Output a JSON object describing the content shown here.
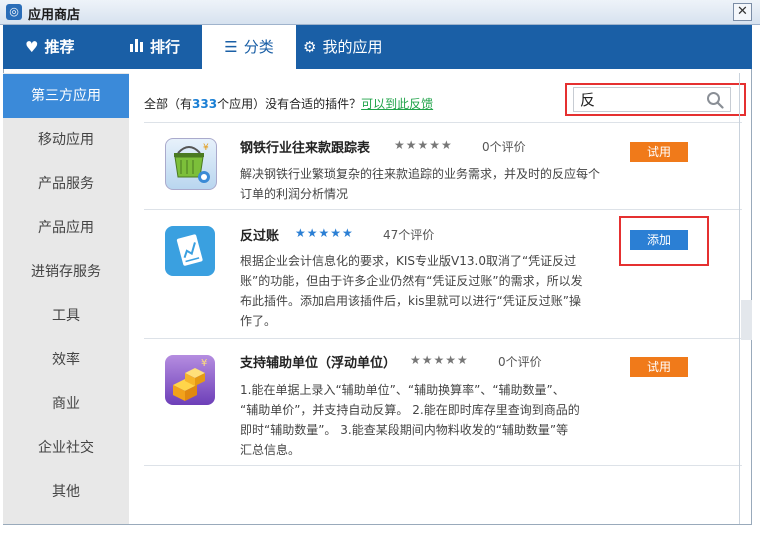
{
  "window": {
    "title": "应用商店",
    "close_glyph": "✕"
  },
  "tabs": [
    {
      "label": "推荐",
      "icon": "heart-icon",
      "glyph": "♥"
    },
    {
      "label": "排行",
      "icon": "bar-chart-icon",
      "glyph": "📊"
    },
    {
      "label": "分类",
      "icon": "list-icon",
      "glyph": "☰"
    },
    {
      "label": "我的应用",
      "icon": "gear-icon",
      "glyph": "⚙"
    }
  ],
  "active_tab": "分类",
  "sidebar": {
    "items": [
      "第三方应用",
      "移动应用",
      "产品服务",
      "产品应用",
      "进销存服务",
      "工具",
      "效率",
      "商业",
      "企业社交",
      "其他"
    ],
    "active": "第三方应用"
  },
  "summary": {
    "prefix": "全部（有",
    "count": "333",
    "suffix": "个应用）没有合适的插件？",
    "link": "可以到此反馈"
  },
  "search": {
    "value": "反",
    "placeholder": ""
  },
  "apps": [
    {
      "name": "钢铁行业往来款跟踪表",
      "stars": "★★★★★",
      "rating": "0个评价",
      "button": "试用",
      "desc": [
        "解决钢铁行业繁琐复杂的往来款追踪的业务需求，并及时的反应每个",
        "订单的利润分析情况"
      ]
    },
    {
      "name": "反过账",
      "stars": "★★★★★",
      "rating": "47个评价",
      "button": "添加",
      "desc": [
        "根据企业会计信息化的要求，KIS专业版V13.0取消了“凭证反过",
        "账”的功能，但由于许多企业仍然有“凭证反过账”的需求，所以发",
        "布此插件。添加启用该插件后，kis里就可以进行“凭证反过账”操",
        "作了。"
      ]
    },
    {
      "name": "支持辅助单位（浮动单位）",
      "stars": "★★★★★",
      "rating": "0个评价",
      "button": "试用",
      "desc": [
        "1.能在单据上录入“辅助单位”、“辅助换算率”、“辅助数量”、",
        "“辅助单价”，并支持自动反算。 2.能在即时库存里查询到商品的",
        "即时“辅助数量”。 3.能查某段期间内物料收发的“辅助数量”等",
        "汇总信息。"
      ]
    }
  ],
  "colors": {
    "brand_blue": "#1a5fa6",
    "accent_blue": "#3b8ad9",
    "try_orange": "#f07a1a",
    "add_blue": "#2b7fd4",
    "highlight_red": "#e53030",
    "star_gray": "#777777",
    "star_blue": "#2b7fd4"
  }
}
